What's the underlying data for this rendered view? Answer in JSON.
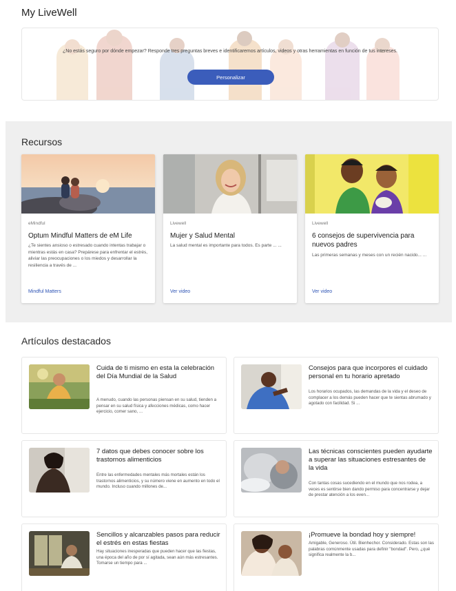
{
  "page": {
    "title": "My LiveWell"
  },
  "personalize": {
    "prompt": "¿No estás seguro por dónde empezar? Responde tres preguntas breves e identificaremos artículos, videos y otras herramientas en función de tus intereses.",
    "button_label": "Personalizar"
  },
  "resources": {
    "title": "Recursos",
    "cards": [
      {
        "source": "eMindful",
        "title": "Optum Mindful Matters de eM Life",
        "description": "¿Te sientes ansioso o estresado cuando intentas trabajar o mientras estás en casa? Prepárese para enfrentar el estrés, aliviar las preocupaciones o los miedos y desarrollar la resiliencia a través de ...",
        "link": "Mindful Matters",
        "image_icon": "sunset-couple-image"
      },
      {
        "source": "Livewell",
        "title": "Mujer y Salud Mental",
        "description": "La salud mental es importante para todos. Es parte ... ...",
        "link": "Ver video",
        "image_icon": "smiling-woman-image"
      },
      {
        "source": "Livewell",
        "title": "6 consejos de supervivencia para nuevos padres",
        "description": "Las primeras semanas y meses con un recién nacido... ...",
        "link": "Ver video",
        "image_icon": "animated-parents-image"
      }
    ]
  },
  "featured": {
    "title": "Artículos destacados",
    "articles": [
      {
        "title": "Cuida de ti mismo en esta la celebración del Día Mundial de la Salud",
        "description": "A menudo, cuando las personas piensan en su salud, tienden a pensar en su salud física y afecciones médicas, como hacer ejercicio, comer sano, ...",
        "image_icon": "woman-in-garden-image"
      },
      {
        "title": "Consejos para que incorpores el cuidado personal en tu horario apretado",
        "description": "Los horarios ocupados, las demandas de la vida y el deseo de complacer a los demás pueden hacer que te sientas abrumado y agotado con facilidad. Si ...",
        "image_icon": "relaxed-man-image"
      },
      {
        "title": "7 datos que debes conocer sobre los trastornos alimenticios",
        "description": "Entre las enfermedades mentales más mortales están los trastornos alimenticios, y su número viene en aumento en todo el mundo. Incluso cuando millones de...",
        "image_icon": "pensive-woman-image"
      },
      {
        "title": "Las técnicas conscientes pueden ayudarte a superar las situaciones estresantes de la vida",
        "description": "Con tantas cosas sucediendo en el mundo que nos rodea, a veces es sentirse bien dando permiso para concentrarse y dejar de prestar atención a los even...",
        "image_icon": "blurred-woman-image"
      },
      {
        "title": "Sencillos y alcanzables pasos para reducir el estrés en estas fiestas",
        "description": "Hay situaciones inesperadas que pueden hacer que las fiestas, una época del año de por sí agitada, sean aún más estresantes. Tomarse un tiempo para ...",
        "image_icon": "woman-by-window-image"
      },
      {
        "title": "¡Promueve la bondad hoy y siempre!",
        "description": "Amigable, Generoso. Útil. Bienhechor. Considerado. Estas son las palabras comúnmente usadas para definir \"bondad\". Pero, ¿qué significa realmente la b...",
        "image_icon": "mother-and-child-image"
      }
    ]
  }
}
